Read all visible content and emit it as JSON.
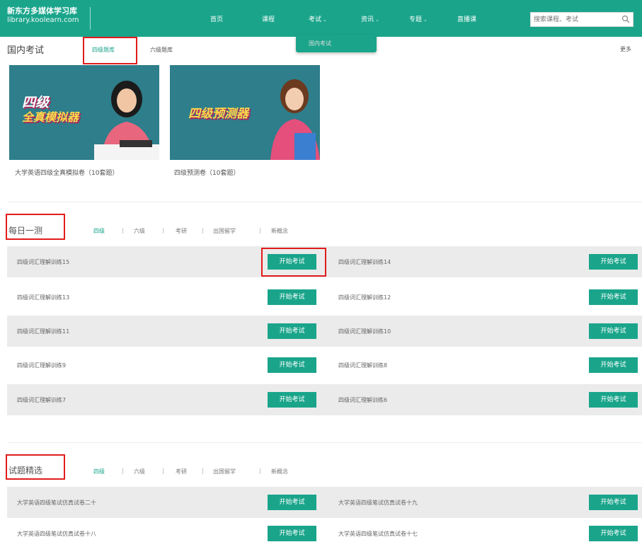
{
  "header": {
    "logo_line1": "新东方多媒体学习库",
    "logo_line2": "library.koolearn.com",
    "nav": [
      {
        "label": "首页",
        "has_dropdown": false
      },
      {
        "label": "课程",
        "has_dropdown": false
      },
      {
        "label": "考试",
        "has_dropdown": true
      },
      {
        "label": "资讯",
        "has_dropdown": true
      },
      {
        "label": "专题",
        "has_dropdown": true
      },
      {
        "label": "直播课",
        "has_dropdown": false
      }
    ],
    "search_placeholder": "搜索课程、考试",
    "dropdown_item": "国内考试"
  },
  "domestic": {
    "title": "国内考试",
    "tabs": [
      "四级题库",
      "六级题库"
    ],
    "more": "更多",
    "cards": [
      {
        "banner_line1": "四级",
        "banner_line2": "全真模拟器",
        "caption": "大学英语四级全真模拟卷（10套题）"
      },
      {
        "banner": "四级预测器",
        "caption": "四级预测卷（10套题）"
      }
    ]
  },
  "daily": {
    "title": "每日一测",
    "tabs": [
      "四级",
      "六级",
      "考研",
      "出国留学",
      "新概念"
    ],
    "separator": "|",
    "button_label": "开始考试",
    "items": [
      [
        "四级词汇理解训练15",
        "四级词汇理解训练14"
      ],
      [
        "四级词汇理解训练13",
        "四级词汇理解训练12"
      ],
      [
        "四级词汇理解训练11",
        "四级词汇理解训练10"
      ],
      [
        "四级词汇理解训练9",
        "四级词汇理解训练8"
      ],
      [
        "四级词汇理解训练7",
        "四级词汇理解训练6"
      ]
    ]
  },
  "selected": {
    "title": "试题精选",
    "tabs": [
      "四级",
      "六级",
      "考研",
      "出国留学",
      "新概念"
    ],
    "items": [
      [
        "大学英语四级笔试仿真试卷二十",
        "大学英语四级笔试仿真试卷十九"
      ],
      [
        "大学英语四级笔试仿真试卷十八",
        "大学英语四级笔试仿真试卷十七"
      ]
    ]
  },
  "colors": {
    "brand": "#1aa58b",
    "highlight": "#e01c1c",
    "row_shade": "#ebebeb"
  }
}
